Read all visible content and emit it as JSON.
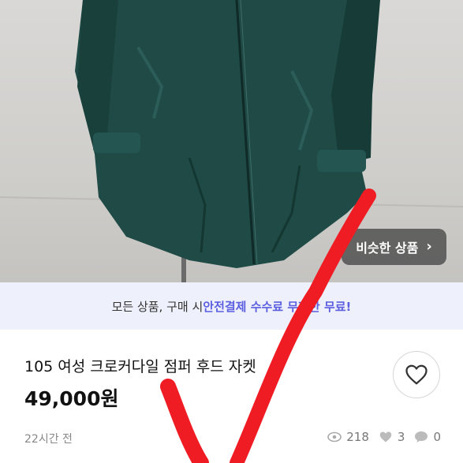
{
  "similar_button": {
    "label": "비슷한 상품",
    "chevron": "›"
  },
  "promo": {
    "prefix": "모든 상품, 구매 시 ",
    "highlight": "안전결제 수수료 무제한 무료!"
  },
  "product": {
    "title": "105 여성 크로커다일 점퍼 후드 자켓",
    "price": "49,000원",
    "posted_time": "22시간 전"
  },
  "stats": {
    "views": "218",
    "likes": "3",
    "chats": "0"
  },
  "icons": {
    "favorite": "heart-outline-icon",
    "views": "eye-icon",
    "likes": "heart-icon",
    "chats": "chat-bubble-icon"
  },
  "colors": {
    "accent": "#5b5fe0",
    "annotation": "#f01c24",
    "jacket": "#1f4a45"
  }
}
